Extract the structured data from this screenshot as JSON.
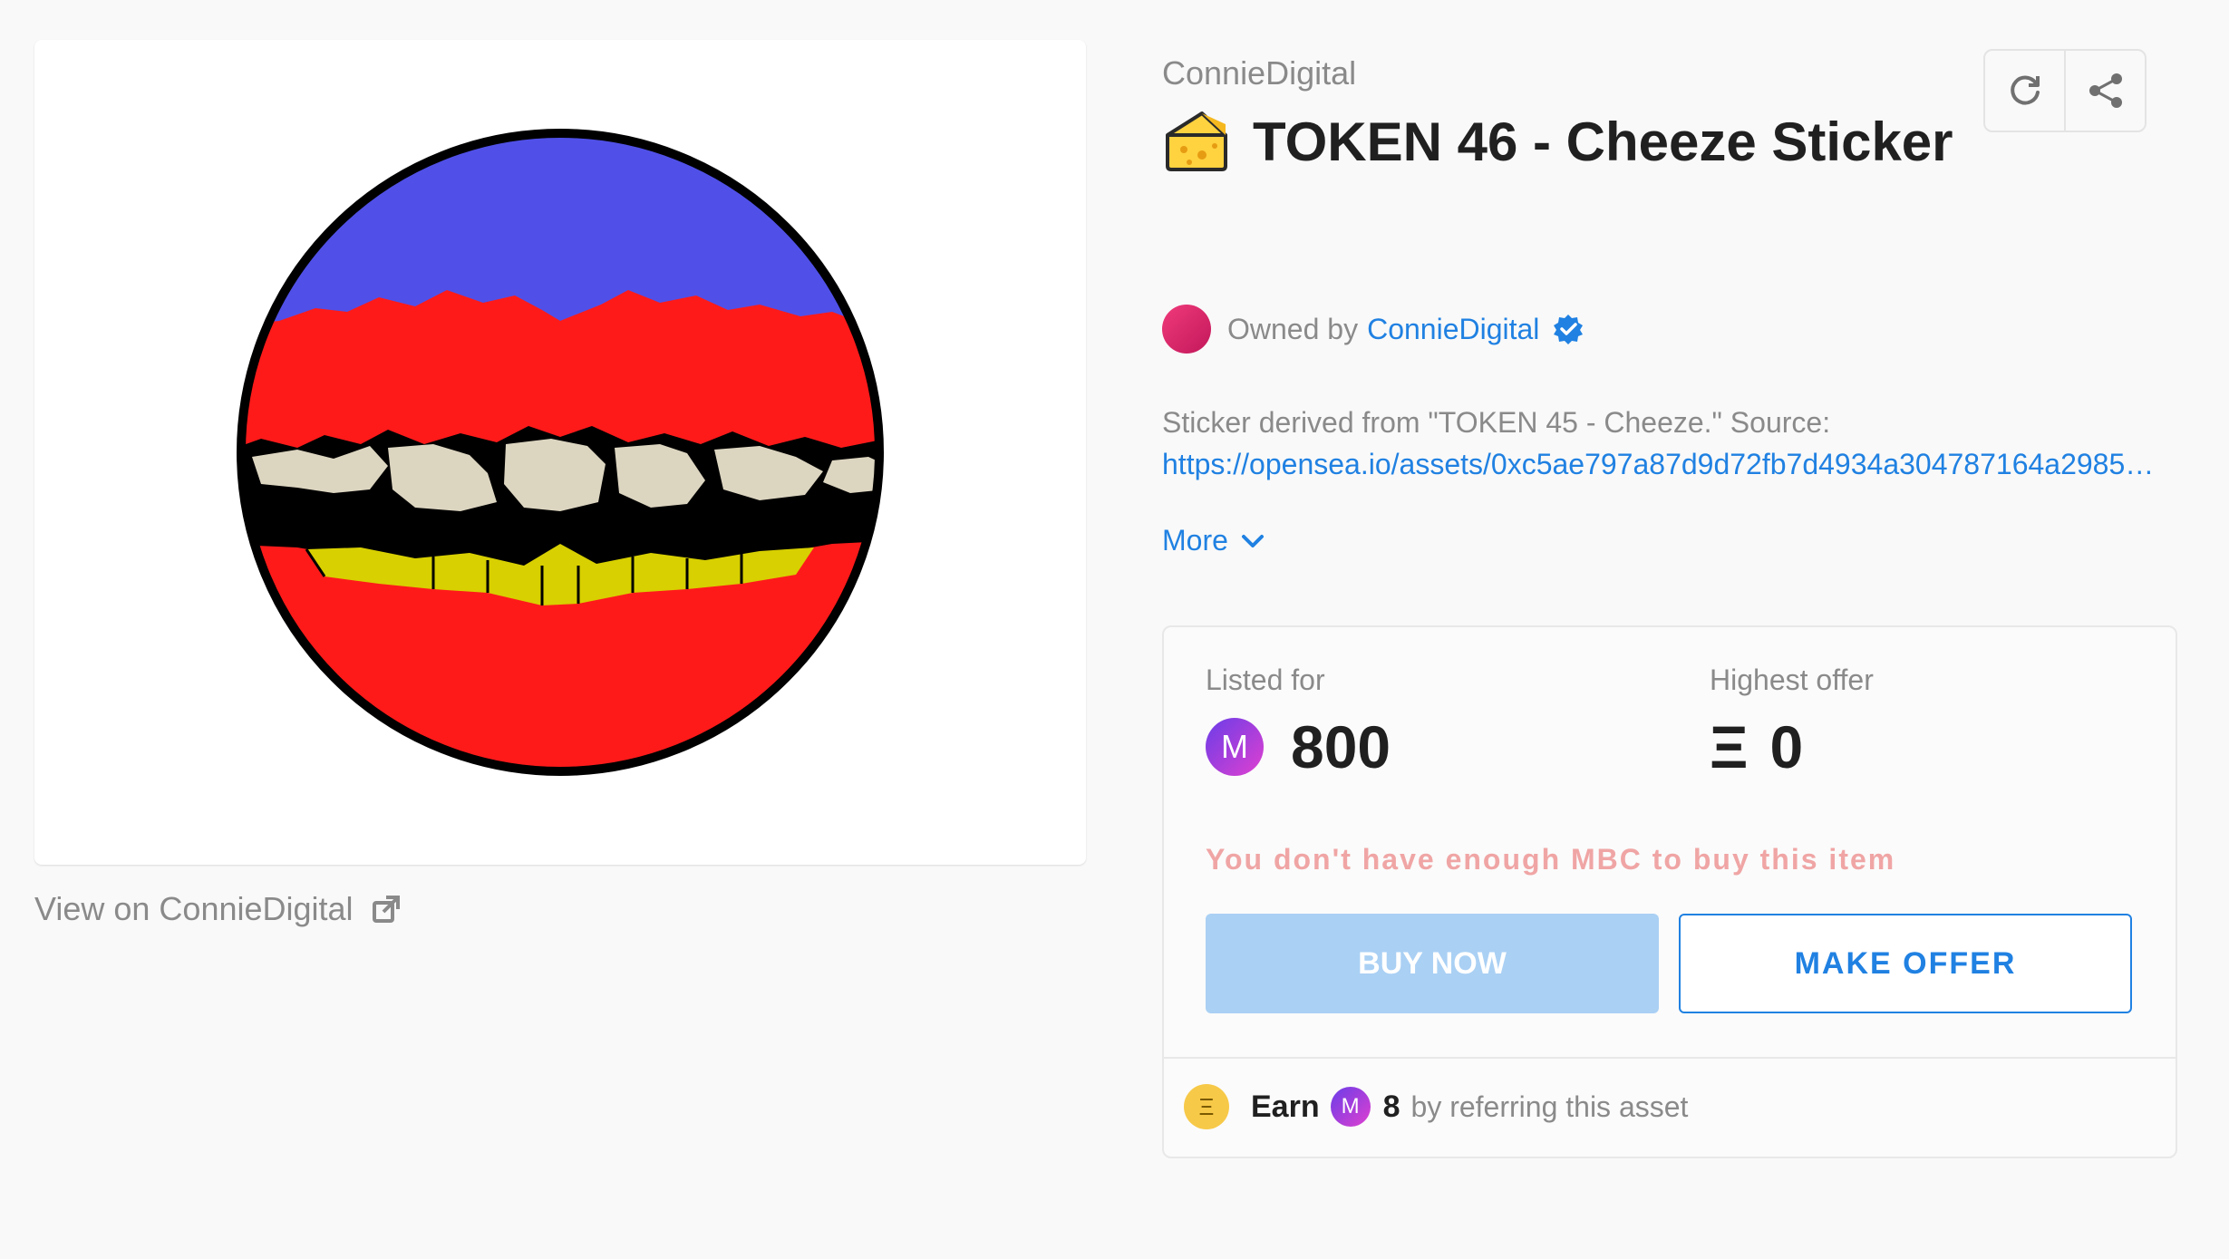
{
  "asset": {
    "collection": "ConnieDigital",
    "title": "TOKEN 46 - Cheeze Sticker",
    "view_on_label": "View on ConnieDigital",
    "owner_prefix": "Owned by",
    "owner_name": "ConnieDigital",
    "description": "Sticker derived from \"TOKEN 45 - Cheeze.\" Source:",
    "source_link": "https://opensea.io/assets/0xc5ae797a87d9d72fb7d4934a304787164a29857a…",
    "more_label": "More"
  },
  "toolbar": {
    "refresh_icon": "refresh-icon",
    "share_icon": "share-icon"
  },
  "trade": {
    "listed_label": "Listed for",
    "listed_coin": "M",
    "listed_price": "800",
    "offer_label": "Highest offer",
    "offer_symbol": "Ξ",
    "offer_price": "0",
    "warning": "You don't have enough MBC to buy this item",
    "buy_label": "BUY NOW",
    "offer_button_label": "MAKE OFFER"
  },
  "referral": {
    "coin_symbol": "Ξ",
    "earn_label": "Earn",
    "reward_coin": "M",
    "reward_amount": "8",
    "suffix": "by referring this asset"
  },
  "colors": {
    "accent": "#2081e2",
    "warning": "#f0a5a5",
    "buy_disabled": "#aad0f4",
    "sticker_red": "#ff1a1a",
    "sticker_blue": "#5050e8",
    "sticker_yellow": "#d8d000"
  }
}
